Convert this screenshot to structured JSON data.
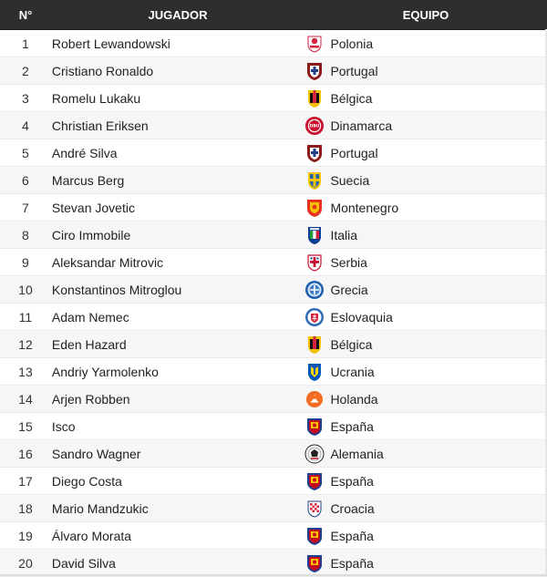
{
  "table": {
    "headers": {
      "number": "N°",
      "player": "JUGADOR",
      "team": "EQUIPO"
    },
    "rows": [
      {
        "n": "1",
        "player": "Robert Lewandowski",
        "team": "Polonia",
        "crest": "poland-crest-icon"
      },
      {
        "n": "2",
        "player": "Cristiano Ronaldo",
        "team": "Portugal",
        "crest": "portugal-crest-icon"
      },
      {
        "n": "3",
        "player": "Romelu Lukaku",
        "team": "Bélgica",
        "crest": "belgium-crest-icon"
      },
      {
        "n": "4",
        "player": "Christian Eriksen",
        "team": "Dinamarca",
        "crest": "denmark-crest-icon"
      },
      {
        "n": "5",
        "player": "André Silva",
        "team": "Portugal",
        "crest": "portugal-crest-icon"
      },
      {
        "n": "6",
        "player": "Marcus Berg",
        "team": "Suecia",
        "crest": "sweden-crest-icon"
      },
      {
        "n": "7",
        "player": "Stevan Jovetic",
        "team": "Montenegro",
        "crest": "montenegro-crest-icon"
      },
      {
        "n": "8",
        "player": "Ciro Immobile",
        "team": "Italia",
        "crest": "italy-crest-icon"
      },
      {
        "n": "9",
        "player": "Aleksandar Mitrovic",
        "team": "Serbia",
        "crest": "serbia-crest-icon"
      },
      {
        "n": "10",
        "player": "Konstantinos Mitroglou",
        "team": "Grecia",
        "crest": "greece-crest-icon"
      },
      {
        "n": "11",
        "player": "Adam Nemec",
        "team": "Eslovaquia",
        "crest": "slovakia-crest-icon"
      },
      {
        "n": "12",
        "player": "Eden Hazard",
        "team": "Bélgica",
        "crest": "belgium-crest-icon"
      },
      {
        "n": "13",
        "player": "Andriy Yarmolenko",
        "team": "Ucrania",
        "crest": "ukraine-crest-icon"
      },
      {
        "n": "14",
        "player": "Arjen Robben",
        "team": "Holanda",
        "crest": "netherlands-crest-icon"
      },
      {
        "n": "15",
        "player": "Isco",
        "team": "España",
        "crest": "spain-crest-icon"
      },
      {
        "n": "16",
        "player": "Sandro Wagner",
        "team": "Alemania",
        "crest": "germany-crest-icon"
      },
      {
        "n": "17",
        "player": "Diego Costa",
        "team": "España",
        "crest": "spain-crest-icon"
      },
      {
        "n": "18",
        "player": "Mario Mandzukic",
        "team": "Croacia",
        "crest": "croatia-crest-icon"
      },
      {
        "n": "19",
        "player": "Álvaro Morata",
        "team": "España",
        "crest": "spain-crest-icon"
      },
      {
        "n": "20",
        "player": "David Silva",
        "team": "España",
        "crest": "spain-crest-icon"
      }
    ]
  },
  "colors": {
    "header_bg": "#2e2e2e",
    "row_alt_bg": "#f6f6f6",
    "row_bg": "#ffffff"
  }
}
